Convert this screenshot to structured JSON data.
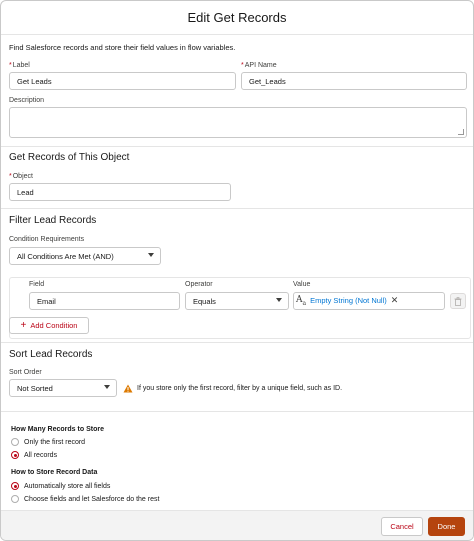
{
  "modal": {
    "title": "Edit Get Records",
    "description_text": "Find Salesforce records and store their field values in flow variables."
  },
  "fields": {
    "label": {
      "label": "Label",
      "value": "Get Leads"
    },
    "api_name": {
      "label": "API Name",
      "value": "Get_Leads"
    },
    "description": {
      "label": "Description",
      "value": ""
    }
  },
  "object_section": {
    "title": "Get Records of This Object",
    "object_label": "Object",
    "object_value": "Lead"
  },
  "filter_section": {
    "title": "Filter Lead Records",
    "condition_req_label": "Condition Requirements",
    "condition_req_value": "All Conditions Are Met (AND)",
    "headers": {
      "field": "Field",
      "operator": "Operator",
      "value": "Value"
    },
    "condition": {
      "field": "Email",
      "operator": "Equals",
      "value_icon_text": "A",
      "value_icon_sub": "a",
      "value": "Empty String (Not Null)"
    },
    "add_condition_label": "Add Condition"
  },
  "sort_section": {
    "title": "Sort Lead Records",
    "sort_order_label": "Sort Order",
    "sort_order_value": "Not Sorted",
    "warning_text": "If you store only the first record, filter by a unique field, such as ID."
  },
  "store_section": {
    "how_many_title": "How Many Records to Store",
    "how_many_options": [
      {
        "label": "Only the first record",
        "selected": false
      },
      {
        "label": "All records",
        "selected": true
      }
    ],
    "how_store_title": "How to Store Record Data",
    "how_store_options": [
      {
        "label": "Automatically store all fields",
        "selected": true
      },
      {
        "label": "Choose fields and let Salesforce do the rest",
        "selected": false
      }
    ]
  },
  "footer": {
    "cancel_label": "Cancel",
    "done_label": "Done"
  },
  "colors": {
    "brand": "#b5440e",
    "required": "#ba0517",
    "link": "#0176d3",
    "warning": "#dd7a01"
  },
  "icons": {
    "add": "add-icon",
    "warning": "warning-icon",
    "trash": "delete-icon",
    "text_type": "text-type-icon",
    "clear": "close-icon",
    "dropdown": "chevron-down-icon"
  }
}
